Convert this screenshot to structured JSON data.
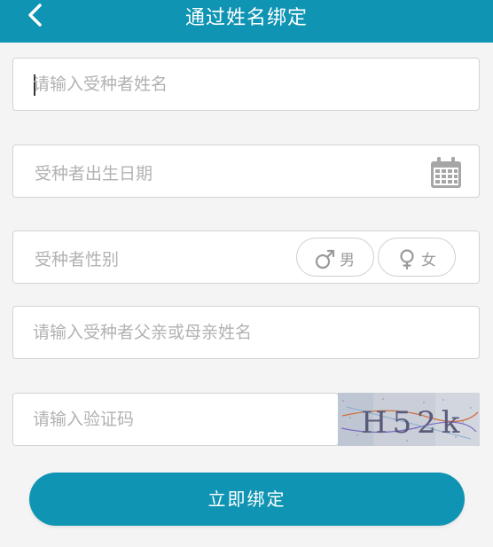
{
  "header": {
    "title": "通过姓名绑定",
    "back_icon": "chevron-left-icon"
  },
  "form": {
    "name_placeholder": "请输入受种者姓名",
    "birthdate_label": "受种者出生日期",
    "calendar_icon": "calendar-icon",
    "gender_label": "受种者性别",
    "gender_options": [
      {
        "label": "男",
        "icon": "male-icon"
      },
      {
        "label": "女",
        "icon": "female-icon"
      }
    ],
    "parent_name_placeholder": "请输入受种者父亲或母亲姓名",
    "captcha_placeholder": "请输入验证码",
    "captcha_text": "H52k"
  },
  "actions": {
    "bind_label": "立即绑定"
  },
  "colors": {
    "accent": "#0f94b3",
    "background": "#f4f4f4",
    "placeholder": "#b2b2b2"
  }
}
